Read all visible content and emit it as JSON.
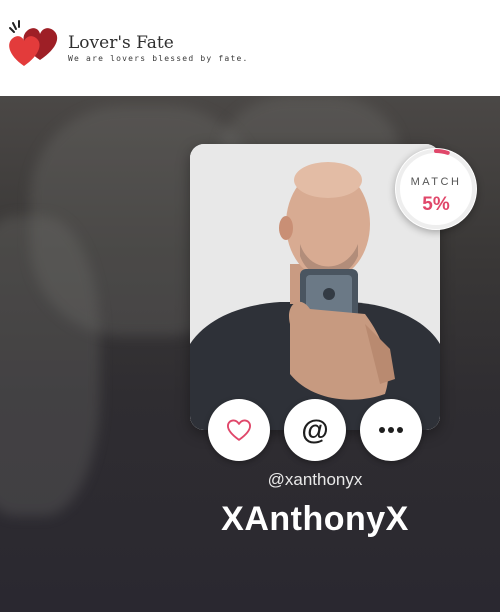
{
  "brand": {
    "name": "Lover's Fate",
    "tagline": "We are lovers blessed by fate."
  },
  "match": {
    "label": "MATCH",
    "value": "5%",
    "fraction": 0.05
  },
  "profile": {
    "username": "@xanthonyx",
    "display_name": "XAnthonyX"
  },
  "actions": {
    "like_icon": "heart-outline-icon",
    "mention_icon": "at-icon",
    "mention_glyph": "@",
    "more_icon": "more-dots-icon"
  },
  "colors": {
    "accent": "#e0476a",
    "logo_red": "#d93a3a",
    "logo_dark_red": "#9e1f26",
    "hero_dark": "#2a2830"
  }
}
